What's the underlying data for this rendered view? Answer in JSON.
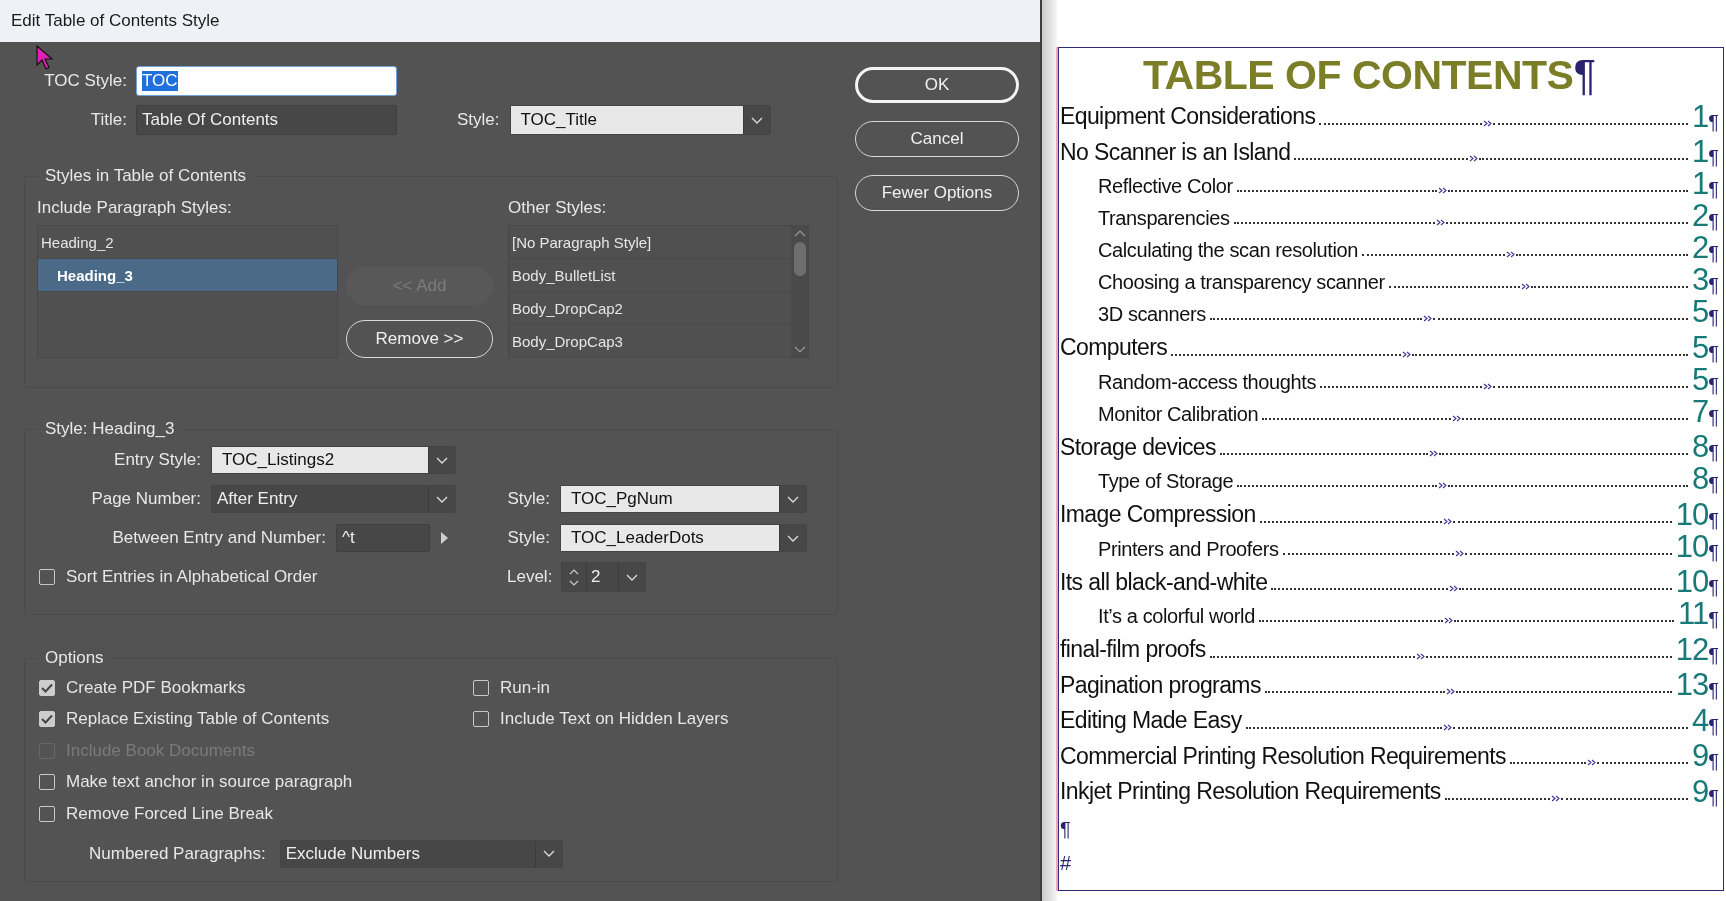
{
  "window": {
    "title": "Edit Table of Contents Style"
  },
  "toc_style": {
    "label": "TOC Style:",
    "value": "TOC",
    "text_selected": true
  },
  "title_field": {
    "label": "Title:",
    "value": "Table Of Contents"
  },
  "title_style": {
    "label": "Style:",
    "value": "TOC_Title"
  },
  "buttons": [
    {
      "label": "OK",
      "default": true
    },
    {
      "label": "Cancel",
      "default": false
    },
    {
      "label": "Fewer Options",
      "default": false
    }
  ],
  "styles_group": {
    "title": "Styles in Table of Contents",
    "include_label": "Include Paragraph Styles:",
    "include_items": [
      {
        "label": "Heading_2",
        "selected": false,
        "children": [
          {
            "label": "Heading_3",
            "selected": true
          }
        ]
      }
    ],
    "add_button": {
      "label": "<< Add",
      "disabled": true
    },
    "remove_button": {
      "label": "Remove >>",
      "disabled": false
    },
    "other_label": "Other Styles:",
    "other_items": [
      {
        "label": "[No Paragraph Style]",
        "selected": false
      },
      {
        "label": "Body_BulletList",
        "selected": false
      },
      {
        "label": "Body_DropCap2",
        "selected": false
      },
      {
        "label": "Body_DropCap3",
        "selected": false
      }
    ]
  },
  "entry_group": {
    "title": "Style: Heading_3",
    "entry_style": {
      "label": "Entry Style:",
      "value": "TOC_Listings2"
    },
    "page_number": {
      "label": "Page Number:",
      "value": "After Entry"
    },
    "page_number_style": {
      "label": "Style:",
      "value": "TOC_PgNum"
    },
    "between": {
      "label": "Between Entry and Number:",
      "value": "^t"
    },
    "between_style": {
      "label": "Style:",
      "value": "TOC_LeaderDots"
    },
    "sort": {
      "label": "Sort Entries in Alphabetical Order",
      "checked": false
    },
    "level": {
      "label": "Level:",
      "value": "2"
    }
  },
  "options_group": {
    "title": "Options",
    "left_checkboxes": [
      {
        "label": "Create PDF Bookmarks",
        "checked": true,
        "disabled": false
      },
      {
        "label": "Replace Existing Table of Contents",
        "checked": true,
        "disabled": false
      },
      {
        "label": "Include Book Documents",
        "checked": false,
        "disabled": true
      },
      {
        "label": "Make text anchor in source paragraph",
        "checked": false,
        "disabled": false
      },
      {
        "label": "Remove Forced Line Break",
        "checked": false,
        "disabled": false
      }
    ],
    "right_checkboxes": [
      {
        "label": "Run-in",
        "checked": false,
        "disabled": false
      },
      {
        "label": "Include Text on Hidden Layers",
        "checked": false,
        "disabled": false
      }
    ],
    "numbered_paragraphs": {
      "label": "Numbered Paragraphs:",
      "value": "Exclude Numbers"
    }
  },
  "document": {
    "heading": "TABLE OF CONTENTS",
    "heading_mark": "¶",
    "entries": [
      {
        "text": "Equipment Considerations",
        "page": "1",
        "mark": "¶"
      },
      {
        "text": "No Scanner is an Island",
        "page": "1",
        "mark": "¶",
        "children": [
          {
            "text": "Reflective Color",
            "page": "1",
            "mark": "¶"
          },
          {
            "text": "Transparencies",
            "page": "2",
            "mark": "¶"
          },
          {
            "text": "Calculating the scan resolution",
            "page": "2",
            "mark": "¶"
          },
          {
            "text": "Choosing a transparency scanner",
            "page": "3",
            "mark": "¶"
          },
          {
            "text": "3D scanners",
            "page": "5",
            "mark": "¶"
          }
        ]
      },
      {
        "text": "Computers",
        "page": "5",
        "mark": "¶",
        "children": [
          {
            "text": "Random-access thoughts",
            "page": "5",
            "mark": "¶"
          },
          {
            "text": "Monitor Calibration",
            "page": "7",
            "mark": "¶"
          }
        ]
      },
      {
        "text": "Storage devices",
        "page": "8",
        "mark": "¶",
        "children": [
          {
            "text": "Type of Storage",
            "page": "8",
            "mark": "¶"
          }
        ]
      },
      {
        "text": "Image Compression",
        "page": "10",
        "mark": "¶",
        "children": [
          {
            "text": "Printers and Proofers",
            "page": "10",
            "mark": "¶"
          }
        ]
      },
      {
        "text": "Its all black-and-white",
        "page": "10",
        "mark": "¶",
        "children": [
          {
            "text": "It’s a colorful world",
            "page": "11",
            "mark": "¶"
          }
        ]
      },
      {
        "text": "final-film proofs",
        "page": "12",
        "mark": "¶"
      },
      {
        "text": "Pagination programs",
        "page": "13",
        "mark": "¶"
      },
      {
        "text": "Editing Made Easy",
        "page": "4",
        "mark": "¶"
      },
      {
        "text": "Commercial Printing Resolution Requirements",
        "page": "9",
        "mark": "¶"
      },
      {
        "text": "Inkjet Printing Resolution Requirements",
        "page": "9",
        "mark": "¶"
      }
    ],
    "end_marks": [
      "¶",
      "#"
    ]
  }
}
